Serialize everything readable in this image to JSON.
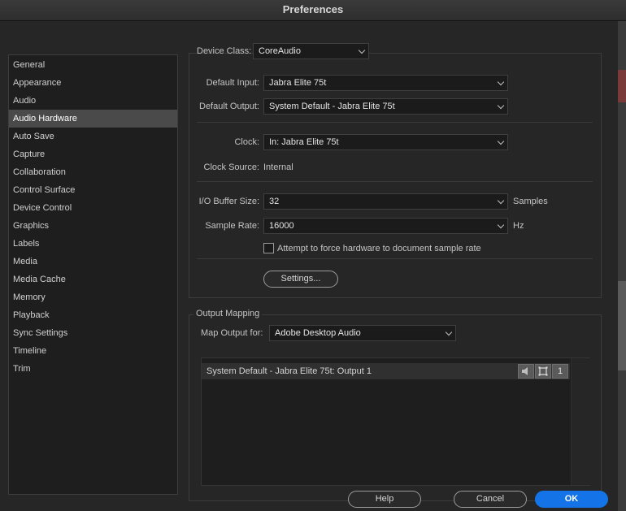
{
  "window": {
    "title": "Preferences"
  },
  "sidebar": {
    "items": [
      {
        "label": "General"
      },
      {
        "label": "Appearance"
      },
      {
        "label": "Audio"
      },
      {
        "label": "Audio Hardware",
        "selected": true
      },
      {
        "label": "Auto Save"
      },
      {
        "label": "Capture"
      },
      {
        "label": "Collaboration"
      },
      {
        "label": "Control Surface"
      },
      {
        "label": "Device Control"
      },
      {
        "label": "Graphics"
      },
      {
        "label": "Labels"
      },
      {
        "label": "Media"
      },
      {
        "label": "Media Cache"
      },
      {
        "label": "Memory"
      },
      {
        "label": "Playback"
      },
      {
        "label": "Sync Settings"
      },
      {
        "label": "Timeline"
      },
      {
        "label": "Trim"
      }
    ]
  },
  "device": {
    "class_label": "Device Class:",
    "class_value": "CoreAudio",
    "default_input_label": "Default Input:",
    "default_input_value": "Jabra Elite 75t",
    "default_output_label": "Default Output:",
    "default_output_value": "System Default - Jabra Elite 75t",
    "clock_label": "Clock:",
    "clock_value": "In: Jabra Elite 75t",
    "clock_source_label": "Clock Source:",
    "clock_source_value": "Internal",
    "buffer_label": "I/O Buffer Size:",
    "buffer_value": "32",
    "buffer_unit": "Samples",
    "rate_label": "Sample Rate:",
    "rate_value": "16000",
    "rate_unit": "Hz",
    "force_rate_label": "Attempt to force hardware to document sample rate",
    "force_rate_checked": false,
    "settings_button": "Settings..."
  },
  "output_mapping": {
    "title": "Output Mapping",
    "map_for_label": "Map Output for:",
    "map_for_value": "Adobe Desktop Audio",
    "row_label": "System Default - Jabra Elite 75t: Output 1",
    "channel_number": "1"
  },
  "footer": {
    "help": "Help",
    "cancel": "Cancel",
    "ok": "OK"
  },
  "colors": {
    "accent": "#1473e6",
    "selected_item": "#4a4a4a",
    "background": "#262626"
  }
}
